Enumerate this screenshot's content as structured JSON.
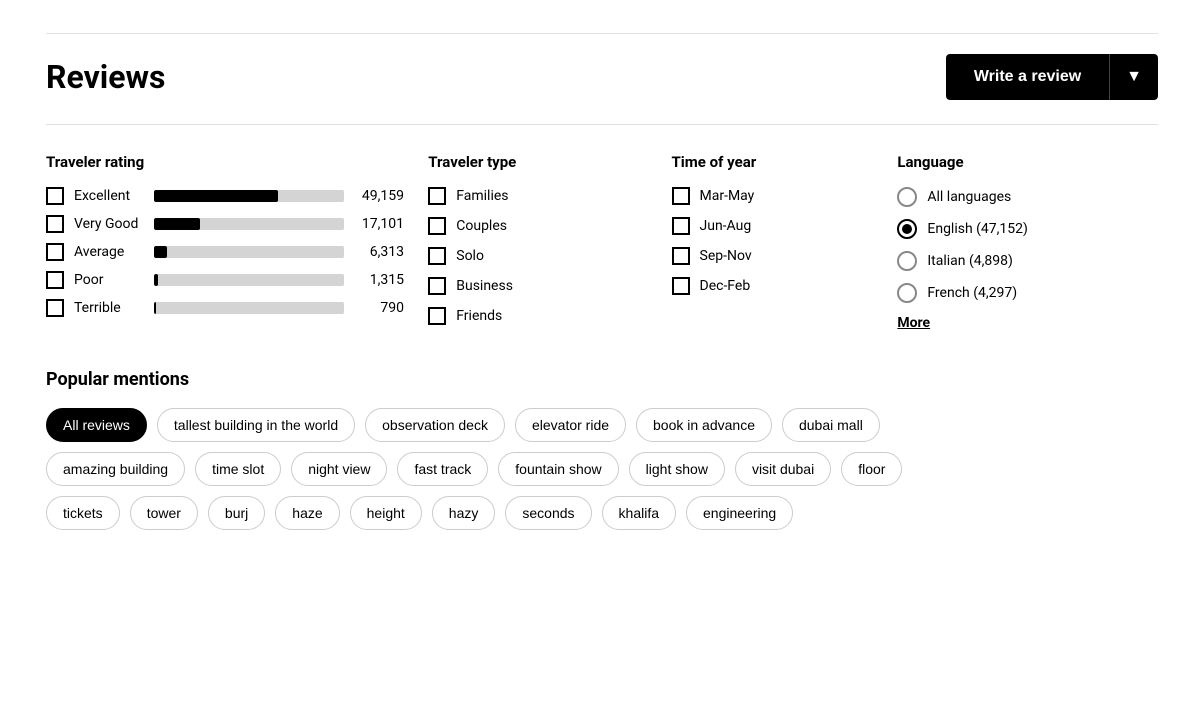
{
  "header": {
    "title": "Reviews",
    "write_review_label": "Write a review",
    "dropdown_icon": "▼"
  },
  "traveler_rating": {
    "title": "Traveler rating",
    "ratings": [
      {
        "label": "Excellent",
        "count": "49,159",
        "bar_pct": 65
      },
      {
        "label": "Very Good",
        "count": "17,101",
        "bar_pct": 24
      },
      {
        "label": "Average",
        "count": "6,313",
        "bar_pct": 7
      },
      {
        "label": "Poor",
        "count": "1,315",
        "bar_pct": 2
      },
      {
        "label": "Terrible",
        "count": "790",
        "bar_pct": 1
      }
    ]
  },
  "traveler_type": {
    "title": "Traveler type",
    "types": [
      {
        "label": "Families"
      },
      {
        "label": "Couples"
      },
      {
        "label": "Solo"
      },
      {
        "label": "Business"
      },
      {
        "label": "Friends"
      }
    ]
  },
  "time_of_year": {
    "title": "Time of year",
    "times": [
      {
        "label": "Mar-May"
      },
      {
        "label": "Jun-Aug"
      },
      {
        "label": "Sep-Nov"
      },
      {
        "label": "Dec-Feb"
      }
    ]
  },
  "language": {
    "title": "Language",
    "options": [
      {
        "label": "All languages",
        "count": "",
        "selected": false
      },
      {
        "label": "English (47,152)",
        "count": "",
        "selected": true
      },
      {
        "label": "Italian (4,898)",
        "count": "",
        "selected": false
      },
      {
        "label": "French (4,297)",
        "count": "",
        "selected": false
      }
    ],
    "more_label": "More"
  },
  "popular_mentions": {
    "title": "Popular mentions",
    "rows": [
      [
        {
          "label": "All reviews",
          "active": true
        },
        {
          "label": "tallest building in the world",
          "active": false
        },
        {
          "label": "observation deck",
          "active": false
        },
        {
          "label": "elevator ride",
          "active": false
        },
        {
          "label": "book in advance",
          "active": false
        },
        {
          "label": "dubai mall",
          "active": false
        }
      ],
      [
        {
          "label": "amazing building",
          "active": false
        },
        {
          "label": "time slot",
          "active": false
        },
        {
          "label": "night view",
          "active": false
        },
        {
          "label": "fast track",
          "active": false
        },
        {
          "label": "fountain show",
          "active": false
        },
        {
          "label": "light show",
          "active": false
        },
        {
          "label": "visit dubai",
          "active": false
        },
        {
          "label": "floor",
          "active": false
        }
      ],
      [
        {
          "label": "tickets",
          "active": false
        },
        {
          "label": "tower",
          "active": false
        },
        {
          "label": "burj",
          "active": false
        },
        {
          "label": "haze",
          "active": false
        },
        {
          "label": "height",
          "active": false
        },
        {
          "label": "hazy",
          "active": false
        },
        {
          "label": "seconds",
          "active": false
        },
        {
          "label": "khalifa",
          "active": false
        },
        {
          "label": "engineering",
          "active": false
        }
      ]
    ]
  }
}
